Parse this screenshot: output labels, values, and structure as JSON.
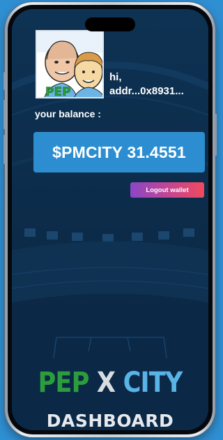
{
  "user": {
    "greeting": "hi,",
    "address": "addr...0x8931..."
  },
  "balance": {
    "label": "your balance :",
    "value": "$PMCITY 31.4551"
  },
  "actions": {
    "logout_label": "Logout wallet"
  },
  "avatar": {
    "badge": "PEP"
  },
  "branding": {
    "pep": "PEP",
    "x": "X",
    "city": "CITY",
    "subtitle": "DASHBOARD"
  },
  "colors": {
    "background": "#0d2d4d",
    "balance_card": "#2c8ed1",
    "logout_gradient_start": "#8b46c6",
    "logout_gradient_end": "#ef4a5e",
    "pep_green": "#2c9d3c",
    "city_blue": "#59b3e6"
  }
}
